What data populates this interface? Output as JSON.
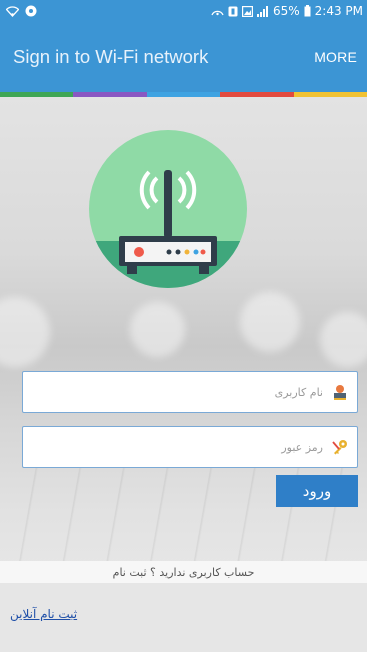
{
  "status_bar": {
    "battery_percent": "65%",
    "time": "2:43 PM",
    "icons": [
      "wifi-icon",
      "location-icon",
      "data-saver-icon",
      "gallery-icon",
      "signal-icon",
      "battery-icon"
    ]
  },
  "app_bar": {
    "title": "Sign in to Wi-Fi network",
    "more_label": "MORE"
  },
  "color_strip": [
    "#3fa656",
    "#8a57c2",
    "#3fa3e2",
    "#e24a3f",
    "#f1c233"
  ],
  "hero": {
    "icon": "wifi-router-icon"
  },
  "form": {
    "username": {
      "placeholder": "نام کاربری",
      "value": "",
      "icon": "user-icon"
    },
    "password": {
      "placeholder": "رمز عبور",
      "value": "",
      "icon": "key-icon"
    },
    "login_label": "ورود"
  },
  "no_account_text": "حساب کاربری ندارید ؟ ثبت نام",
  "online_register_link": "ثبت نام آنلاین",
  "colors": {
    "primary": "#3c95d4",
    "button": "#2f7fc8",
    "field_border": "#7aa9d6"
  }
}
